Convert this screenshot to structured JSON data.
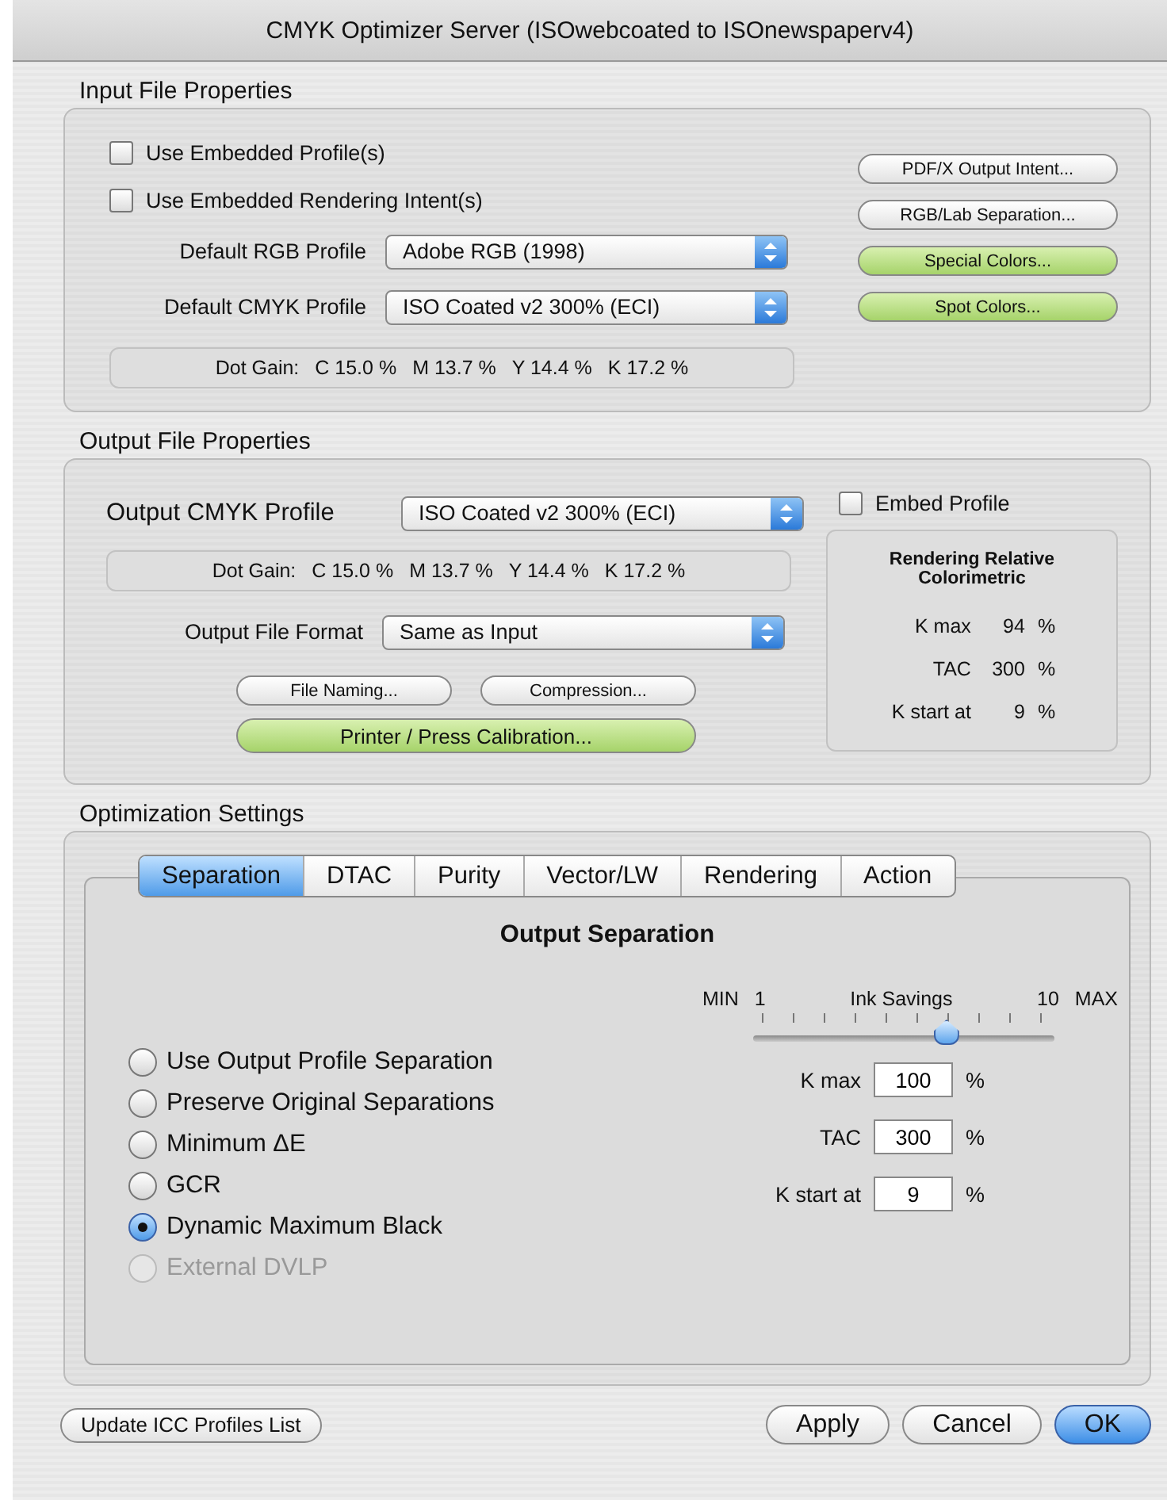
{
  "window": {
    "title": "CMYK Optimizer Server (ISOwebcoated to ISOnewspaperv4)"
  },
  "input_file_properties": {
    "title": "Input File Properties",
    "checkboxes": [
      {
        "label": "Use Embedded Profile(s)",
        "checked": false
      },
      {
        "label": "Use Embedded Rendering Intent(s)",
        "checked": false
      }
    ],
    "selects": [
      {
        "label": "Default RGB Profile",
        "value": "Adobe RGB (1998)"
      },
      {
        "label": "Default CMYK Profile",
        "value": "ISO Coated v2 300% (ECI)"
      }
    ],
    "dot_gain": {
      "label": "Dot Gain:",
      "values": [
        "C 15.0 %",
        "M 13.7 %",
        "Y 14.4 %",
        "K 17.2 %"
      ]
    },
    "buttons": [
      {
        "label": "PDF/X Output Intent...",
        "kind": "plain"
      },
      {
        "label": "RGB/Lab Separation...",
        "kind": "plain"
      },
      {
        "label": "Special Colors...",
        "kind": "green"
      },
      {
        "label": "Spot Colors...",
        "kind": "green"
      }
    ]
  },
  "output_file_properties": {
    "title": "Output File Properties",
    "profile": {
      "label": "Output CMYK Profile",
      "value": "ISO Coated v2 300% (ECI)"
    },
    "embed_profile": {
      "label": "Embed Profile",
      "checked": false
    },
    "dot_gain": {
      "label": "Dot Gain:",
      "values": [
        "C 15.0 %",
        "M 13.7 %",
        "Y 14.4 %",
        "K 17.2 %"
      ]
    },
    "file_format": {
      "label": "Output File Format",
      "value": "Same as Input"
    },
    "buttons": [
      {
        "label": "File Naming...",
        "kind": "plain"
      },
      {
        "label": "Compression...",
        "kind": "plain"
      },
      {
        "label": "Printer / Press Calibration...",
        "kind": "green"
      }
    ],
    "rendering": {
      "title": "Rendering Relative Colorimetric",
      "rows": [
        {
          "label": "K max",
          "value": "94",
          "unit": "%"
        },
        {
          "label": "TAC",
          "value": "300",
          "unit": "%"
        },
        {
          "label": "K start at",
          "value": "9",
          "unit": "%"
        }
      ]
    }
  },
  "optimization_settings": {
    "title": "Optimization Settings",
    "tabs": [
      {
        "label": "Separation",
        "selected": true
      },
      {
        "label": "DTAC",
        "selected": false
      },
      {
        "label": "Purity",
        "selected": false
      },
      {
        "label": "Vector/LW",
        "selected": false
      },
      {
        "label": "Rendering",
        "selected": false
      },
      {
        "label": "Action",
        "selected": false
      }
    ],
    "heading": "Output Separation",
    "radios": [
      {
        "label": "Use Output Profile Separation",
        "selected": false,
        "disabled": false
      },
      {
        "label": "Preserve Original Separations",
        "selected": false,
        "disabled": false
      },
      {
        "label": "Minimum ΔE",
        "selected": false,
        "disabled": false
      },
      {
        "label": "GCR",
        "selected": false,
        "disabled": false
      },
      {
        "label": "Dynamic Maximum Black",
        "selected": true,
        "disabled": false
      },
      {
        "label": "External DVLP",
        "selected": false,
        "disabled": true
      }
    ],
    "slider": {
      "min_label": "MIN",
      "min_value": "1",
      "title": "Ink Savings",
      "max_value": "10",
      "max_label": "MAX",
      "level": 0.67
    },
    "fields": [
      {
        "label": "K max",
        "value": "100",
        "unit": "%"
      },
      {
        "label": "TAC",
        "value": "300",
        "unit": "%"
      },
      {
        "label": "K start at",
        "value": "9",
        "unit": "%"
      }
    ]
  },
  "footer": {
    "left_button": {
      "label": "Update ICC Profiles List"
    },
    "buttons": [
      {
        "label": "Apply",
        "kind": "plain"
      },
      {
        "label": "Cancel",
        "kind": "plain"
      },
      {
        "label": "OK",
        "kind": "default"
      }
    ]
  }
}
